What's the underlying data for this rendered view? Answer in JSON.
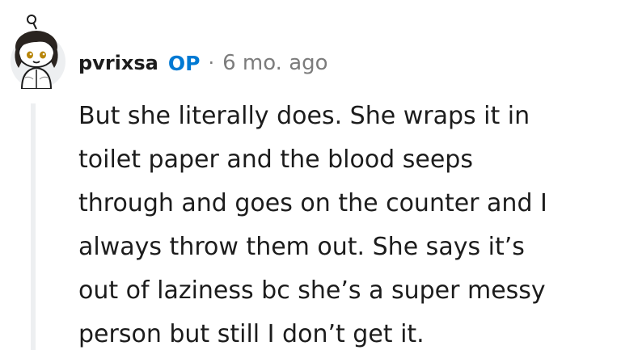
{
  "comment": {
    "author": "pvrixsa",
    "badge": "OP",
    "separator": "·",
    "age": "6 mo. ago",
    "avatar_icon": "snoo-avatar-icon",
    "accent_color": "#0079d3",
    "body_lines": [
      "But she literally does. She wraps it in",
      "toilet paper and the blood seeps",
      "through and goes on the counter and I",
      "always throw them out. She says it’s",
      "out of laziness bc she’s a super messy",
      "person but still I don’t get it."
    ]
  }
}
